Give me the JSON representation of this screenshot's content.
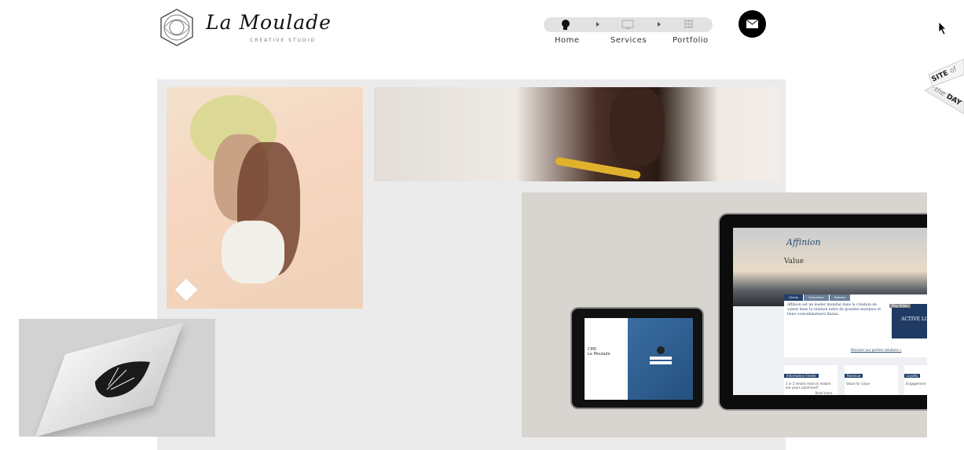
{
  "header": {
    "logo_name": "La Moulade",
    "logo_tagline": "CREATIVE STUDIO"
  },
  "nav": {
    "items": [
      {
        "label": "Home",
        "icon": "head-icon"
      },
      {
        "label": "Services",
        "icon": "monitor-icon"
      },
      {
        "label": "Portfolio",
        "icon": "grid-icon"
      }
    ],
    "contact_icon": "mail-icon"
  },
  "badge": {
    "line1": "SITE",
    "line1b": "of",
    "line2a": "the",
    "line2b": "DAY"
  },
  "portfolio": {
    "small_tablet": {
      "title": "CMS",
      "subtitle": "La Moulade"
    },
    "large_tablet": {
      "brand": "Affinion",
      "hero_word": "Value",
      "tabs": [
        "Clients",
        "Consumers",
        "Partners"
      ],
      "headline": "Affinion est un leader mondial dans la création de valeur dans la relation entre de grandes marques et leurs consommateurs finaux.",
      "promo": "ACTIVE LOYALTY",
      "promo_button": "Play Video",
      "link": "Discover our partner solutions »",
      "cards": [
        "Information Feeder",
        "Revenue",
        "Loyalty"
      ],
      "card_titles": [
        "1 in 5 emails read on mobile - are yours optimised?",
        "Value for value",
        "Engagement and..."
      ],
      "read_more": "Read more..."
    }
  },
  "colors": {
    "panel": "#ebebeb",
    "accent_blue": "#2e5f93",
    "nav_bg": "#e2e2e2"
  }
}
